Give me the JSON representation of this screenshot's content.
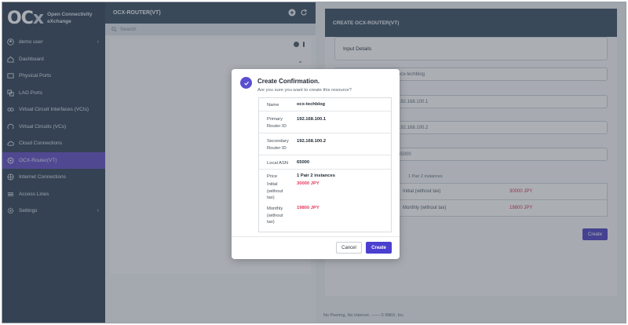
{
  "brand": {
    "mark_o": "O",
    "mark_c": "C",
    "mark_x": "x",
    "line1": "Open Connectivity",
    "line2": "eXchange"
  },
  "sidebar": {
    "items": [
      {
        "label": "demo user",
        "icon": "user-icon",
        "chevron": "›"
      },
      {
        "label": "Dashboard",
        "icon": "home-icon"
      },
      {
        "label": "Physical Ports",
        "icon": "port-icon"
      },
      {
        "label": "LAG Ports",
        "icon": "lag-icon"
      },
      {
        "label": "Virtual Circuit Interfaces (VCIs)",
        "icon": "link-icon"
      },
      {
        "label": "Virtual Circuits (VCs)",
        "icon": "circuit-icon"
      },
      {
        "label": "Cloud Connections",
        "icon": "cloud-icon"
      },
      {
        "label": "OCX-Router(VT)",
        "icon": "router-icon"
      },
      {
        "label": "Internet Connections",
        "icon": "globe-icon"
      },
      {
        "label": "Access Lines",
        "icon": "lines-icon"
      },
      {
        "label": "Settings",
        "icon": "gear-icon",
        "chevron": "›"
      }
    ],
    "active_index": 7
  },
  "list_panel": {
    "title": "OCX-ROUTER(VT)",
    "search_placeholder": "Search",
    "chevron": "⌄"
  },
  "form_panel": {
    "title": "CREATE OCX-ROUTER(VT)",
    "section": "Input Details",
    "fields": [
      "ocx-techblog",
      "192.168.100.1",
      "192.168.100.2",
      "65000"
    ],
    "price_heading": "1 Pair 2 instances",
    "price_rows": [
      {
        "label": "Initial (without tax)",
        "value": "30000 JPY"
      },
      {
        "label": "Monthly (without tax)",
        "value": "19800 JPY"
      }
    ],
    "create_label": "Create",
    "footer": "No Peering, No Internet. —— © BBIX, Inc."
  },
  "modal": {
    "title": "Create Confirmation.",
    "subtitle": "Are you sure you want to create this resource?",
    "rows": [
      {
        "key": "Name",
        "value": "ocx-techblog"
      },
      {
        "key": "Primary Router ID",
        "value": "192.168.100.1"
      },
      {
        "key": "Secondary Router ID",
        "value": "192.168.100.2"
      },
      {
        "key": "Local ASN",
        "value": "65000"
      }
    ],
    "price": {
      "key": "Price",
      "value": "1 Pair 2 instances",
      "initial_key": "Initial (without tax)",
      "initial_value": "30000 JPY",
      "monthly_key": "Monthly (without tax)",
      "monthly_value": "19800 JPY"
    },
    "cancel_label": "Cancel",
    "create_label": "Create"
  },
  "colors": {
    "accent": "#4b3fd0",
    "sidebar": "#3f4f63",
    "active": "#6c5bc9",
    "price_red": "#e2395a"
  }
}
